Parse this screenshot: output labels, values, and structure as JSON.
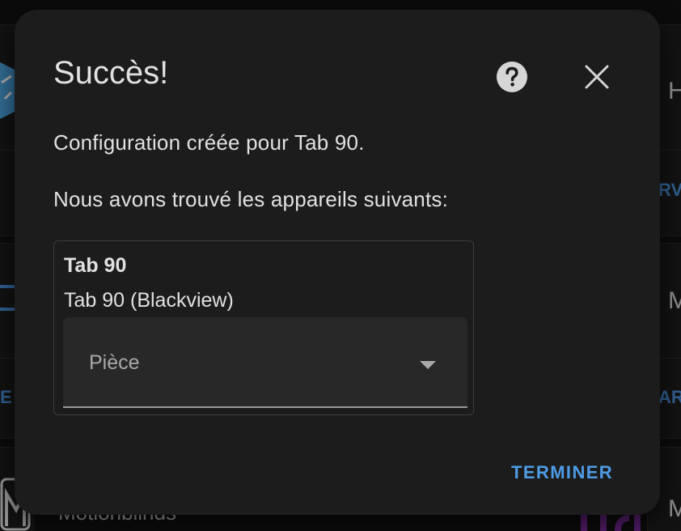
{
  "dialog": {
    "title": "Succès!",
    "message": "Configuration créée pour Tab 90.",
    "devices_intro": "Nous avons trouvé les appareils suivants:",
    "help_icon": "help-circle-icon",
    "close_icon": "close-icon",
    "finish_label": "TERMINER"
  },
  "device": {
    "name": "Tab 90",
    "model": "Tab 90 (Blackview)",
    "area": {
      "label": "Pièce",
      "value": ""
    }
  },
  "background": {
    "right_letters": [
      "H",
      "M",
      "M"
    ],
    "right_links": [
      "RVI",
      "AR"
    ],
    "left_links": [
      "E"
    ],
    "bottom_item": "Motionblinds"
  },
  "colors": {
    "accent": "#4e9ce6",
    "surface": "#1c1c1c",
    "text": "#e1e1e1"
  }
}
